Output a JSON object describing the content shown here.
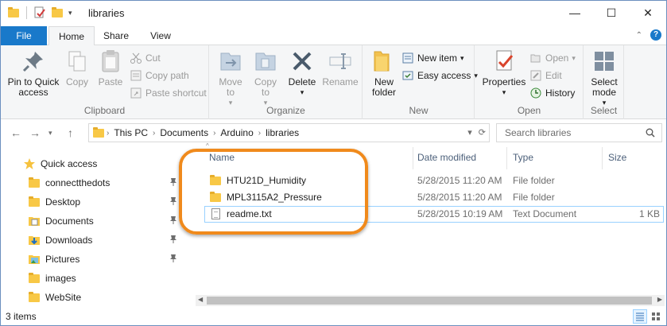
{
  "window": {
    "title": "libraries",
    "controls": {
      "minimize": "—",
      "maximize": "☐",
      "close": "✕"
    }
  },
  "tabs": {
    "file": "File",
    "home": "Home",
    "share": "Share",
    "view": "View"
  },
  "ribbon": {
    "clipboard": {
      "label": "Clipboard",
      "pin_to_quick_access": "Pin to Quick access",
      "copy": "Copy",
      "paste": "Paste",
      "cut": "Cut",
      "copy_path": "Copy path",
      "paste_shortcut": "Paste shortcut"
    },
    "organize": {
      "label": "Organize",
      "move_to": "Move to",
      "copy_to": "Copy to",
      "delete": "Delete",
      "rename": "Rename"
    },
    "new": {
      "label": "New",
      "new_folder": "New folder",
      "new_item": "New item",
      "easy_access": "Easy access"
    },
    "open": {
      "label": "Open",
      "properties": "Properties",
      "open": "Open",
      "edit": "Edit",
      "history": "History"
    },
    "select": {
      "label": "Select",
      "select_mode": "Select mode"
    }
  },
  "address": {
    "crumbs": [
      "This PC",
      "Documents",
      "Arduino",
      "libraries"
    ],
    "search_placeholder": "Search libraries"
  },
  "nav": {
    "items": [
      {
        "label": "Quick access",
        "icon": "star-icon",
        "pinned": false
      },
      {
        "label": "connectthedots",
        "icon": "folder-icon",
        "pinned": true
      },
      {
        "label": "Desktop",
        "icon": "folder-icon",
        "pinned": true
      },
      {
        "label": "Documents",
        "icon": "documents-icon",
        "pinned": true
      },
      {
        "label": "Downloads",
        "icon": "downloads-icon",
        "pinned": true
      },
      {
        "label": "Pictures",
        "icon": "pictures-icon",
        "pinned": true
      },
      {
        "label": "images",
        "icon": "folder-icon",
        "pinned": false
      },
      {
        "label": "WebSite",
        "icon": "folder-icon",
        "pinned": false
      }
    ]
  },
  "columns": {
    "name": "Name",
    "date_modified": "Date modified",
    "type": "Type",
    "size": "Size"
  },
  "files": [
    {
      "name": "HTU21D_Humidity",
      "date": "5/28/2015 11:20 AM",
      "type": "File folder",
      "size": "",
      "icon": "folder-icon"
    },
    {
      "name": "MPL3115A2_Pressure",
      "date": "5/28/2015 11:20 AM",
      "type": "File folder",
      "size": "",
      "icon": "folder-icon"
    },
    {
      "name": "readme.txt",
      "date": "5/28/2015 10:19 AM",
      "type": "Text Document",
      "size": "1 KB",
      "icon": "text-file-icon"
    }
  ],
  "status": {
    "item_count": "3 items"
  },
  "colors": {
    "file_tab": "#1979ca",
    "highlight": "#f08a1c",
    "selection_border": "#99d1ff"
  }
}
